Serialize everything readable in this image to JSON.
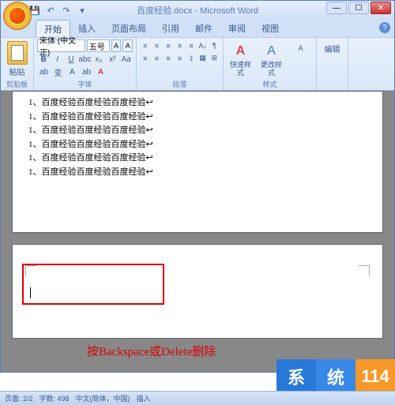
{
  "window": {
    "title": "百度经验.docx - Microsoft Word",
    "min": "—",
    "max": "☐",
    "close": "✕"
  },
  "qat": {
    "save": "💾",
    "undo": "↶",
    "redo": "↷",
    "drop": "▾"
  },
  "tabs": {
    "home": "开始",
    "insert": "插入",
    "layout": "页面布局",
    "references": "引用",
    "mail": "邮件",
    "review": "审阅",
    "view": "视图"
  },
  "ribbon": {
    "clipboard": {
      "paste": "粘贴",
      "label": "剪贴板"
    },
    "font": {
      "name": "宋体 (中文正)",
      "size": "五号",
      "grow": "A",
      "shrink": "A",
      "bold": "B",
      "italic": "I",
      "underline": "U",
      "strike": "abc",
      "sub": "x₂",
      "sup": "x²",
      "caps": "Aa",
      "clear": "ab",
      "phonetic": "变",
      "charborder": "A",
      "highlight": "ab",
      "fontcolor": "A",
      "label": "字体"
    },
    "para": {
      "bullets": "≡",
      "numbers": "≡",
      "multilevel": "≡",
      "indent_dec": "≡",
      "indent_inc": "≡",
      "sort": "A↓",
      "show": "¶",
      "align_l": "≡",
      "align_c": "≡",
      "align_r": "≡",
      "align_j": "≡",
      "spacing": "‡",
      "shade": "▦",
      "border": "⊞",
      "label": "段落"
    },
    "styles": {
      "quick": "快速样式",
      "change": "更改样式",
      "label": "样式"
    },
    "editing": {
      "label": "编辑",
      "find": "A"
    }
  },
  "document": {
    "lines": [
      "1、百度经验百度经验百度经验↩",
      "1、百度经验百度经验百度经验↩",
      "1、百度经验百度经验百度经验↩",
      "1、百度经验百度经验百度经验↩",
      "1、百度经验百度经验百度经验↩",
      "1、百度经验百度经验百度经验↩"
    ]
  },
  "annotation": "按Backspace或Delete删除",
  "watermark": {
    "a": "系",
    "b": "统",
    "c": "114"
  },
  "status": {
    "page": "页面: 2/2",
    "words": "字数: 498",
    "lang": "中文(简体，中国)",
    "mode": "插入"
  }
}
